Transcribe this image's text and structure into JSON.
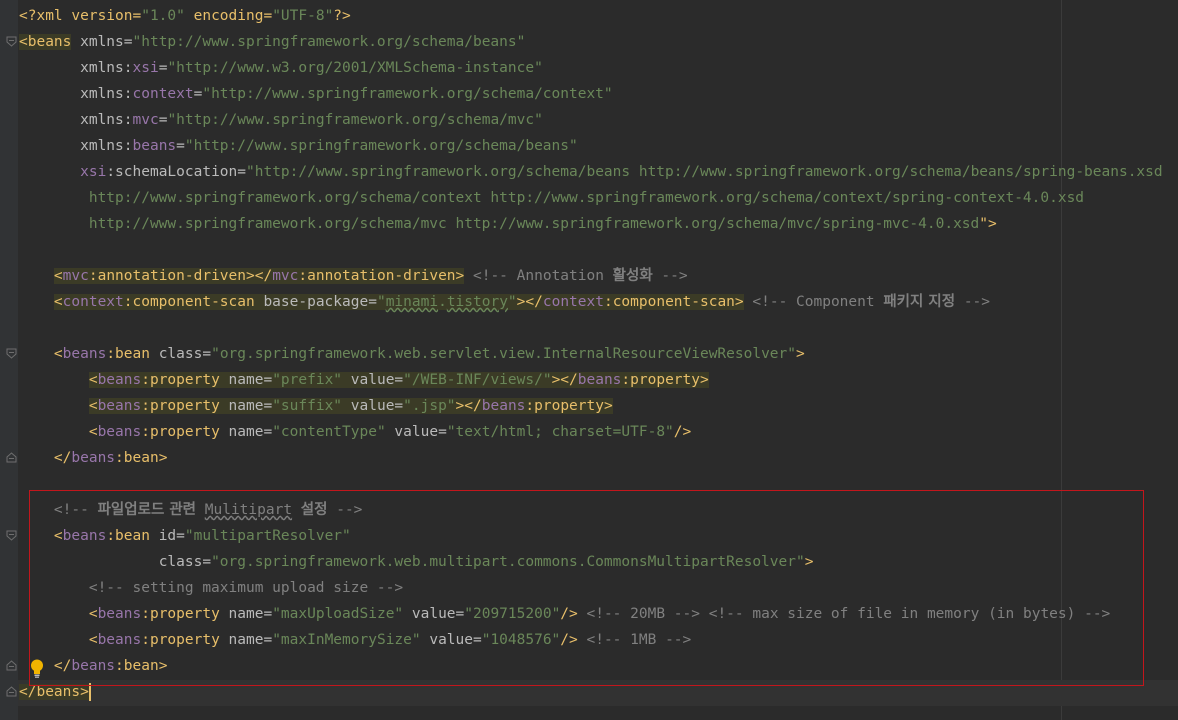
{
  "editor": {
    "lines": [
      {
        "segments": [
          {
            "text": "<?xml version=",
            "cls": "t"
          },
          {
            "text": "\"1.0\"",
            "cls": "v"
          },
          {
            "text": " encoding=",
            "cls": "t"
          },
          {
            "text": "\"UTF-8\"",
            "cls": "v"
          },
          {
            "text": "?>",
            "cls": "t"
          }
        ]
      },
      {
        "segments": [
          {
            "text": "<beans",
            "cls": "t hl"
          },
          {
            "text": " xmlns=",
            "cls": "a"
          },
          {
            "text": "\"http://www.springframework.org/schema/beans\"",
            "cls": "v"
          }
        ]
      },
      {
        "segments": [
          {
            "text": "       xmlns:",
            "cls": "a"
          },
          {
            "text": "xsi",
            "cls": "ns"
          },
          {
            "text": "=",
            "cls": "a"
          },
          {
            "text": "\"http://www.w3.org/2001/XMLSchema-instance\"",
            "cls": "v"
          }
        ]
      },
      {
        "segments": [
          {
            "text": "       xmlns:",
            "cls": "a"
          },
          {
            "text": "context",
            "cls": "ns"
          },
          {
            "text": "=",
            "cls": "a"
          },
          {
            "text": "\"http://www.springframework.org/schema/context\"",
            "cls": "v"
          }
        ]
      },
      {
        "segments": [
          {
            "text": "       xmlns:",
            "cls": "a"
          },
          {
            "text": "mvc",
            "cls": "ns"
          },
          {
            "text": "=",
            "cls": "a"
          },
          {
            "text": "\"http://www.springframework.org/schema/mvc\"",
            "cls": "v"
          }
        ]
      },
      {
        "segments": [
          {
            "text": "       xmlns:",
            "cls": "a"
          },
          {
            "text": "beans",
            "cls": "ns"
          },
          {
            "text": "=",
            "cls": "a"
          },
          {
            "text": "\"http://www.springframework.org/schema/beans\"",
            "cls": "v"
          }
        ]
      },
      {
        "segments": [
          {
            "text": "       ",
            "cls": "a"
          },
          {
            "text": "xsi",
            "cls": "ns"
          },
          {
            "text": ":schemaLocation=",
            "cls": "a"
          },
          {
            "text": "\"http://www.springframework.org/schema/beans http://www.springframework.org/schema/beans/spring-beans.xsd",
            "cls": "v"
          }
        ]
      },
      {
        "segments": [
          {
            "text": "        http://www.springframework.org/schema/context http://www.springframework.org/schema/context/spring-context-4.0.xsd",
            "cls": "v"
          }
        ]
      },
      {
        "segments": [
          {
            "text": "        http://www.springframework.org/schema/mvc http://www.springframework.org/schema/mvc/spring-mvc-4.0.xsd",
            "cls": "v"
          },
          {
            "text": "\">",
            "cls": "t"
          }
        ]
      },
      {
        "segments": []
      },
      {
        "segments": [
          {
            "text": "    ",
            "cls": "a"
          },
          {
            "text": "<",
            "cls": "t hl"
          },
          {
            "text": "mvc",
            "cls": "ns hl"
          },
          {
            "text": ":annotation-driven></",
            "cls": "t hl"
          },
          {
            "text": "mvc",
            "cls": "ns hl"
          },
          {
            "text": ":annotation-driven>",
            "cls": "t hl"
          },
          {
            "text": " <!-- Annotation ",
            "cls": "c"
          },
          {
            "text": "활성화",
            "cls": "c kr"
          },
          {
            "text": " -->",
            "cls": "c"
          }
        ]
      },
      {
        "segments": [
          {
            "text": "    ",
            "cls": "a"
          },
          {
            "text": "<",
            "cls": "t hl"
          },
          {
            "text": "context",
            "cls": "ns hl"
          },
          {
            "text": ":component-scan ",
            "cls": "t hl"
          },
          {
            "text": "base-package=",
            "cls": "a hl"
          },
          {
            "text": "\"",
            "cls": "v hl"
          },
          {
            "text": "minami",
            "cls": "v hl ul"
          },
          {
            "text": ".",
            "cls": "v hl"
          },
          {
            "text": "tistory",
            "cls": "v hl ul"
          },
          {
            "text": "\"",
            "cls": "v hl"
          },
          {
            "text": "></",
            "cls": "t hl"
          },
          {
            "text": "context",
            "cls": "ns hl"
          },
          {
            "text": ":component-scan>",
            "cls": "t hl"
          },
          {
            "text": " <!-- Component ",
            "cls": "c"
          },
          {
            "text": "패키지 지정",
            "cls": "c kr"
          },
          {
            "text": " -->",
            "cls": "c"
          }
        ]
      },
      {
        "segments": []
      },
      {
        "segments": [
          {
            "text": "    <",
            "cls": "t"
          },
          {
            "text": "beans",
            "cls": "ns"
          },
          {
            "text": ":bean ",
            "cls": "t"
          },
          {
            "text": "class=",
            "cls": "a"
          },
          {
            "text": "\"org.springframework.web.servlet.view.InternalResourceViewResolver\"",
            "cls": "v"
          },
          {
            "text": ">",
            "cls": "t"
          }
        ]
      },
      {
        "segments": [
          {
            "text": "        ",
            "cls": "a"
          },
          {
            "text": "<",
            "cls": "t hl"
          },
          {
            "text": "beans",
            "cls": "ns hl"
          },
          {
            "text": ":property ",
            "cls": "t hl"
          },
          {
            "text": "name=",
            "cls": "a hl"
          },
          {
            "text": "\"prefix\"",
            "cls": "v hl"
          },
          {
            "text": " value=",
            "cls": "a hl"
          },
          {
            "text": "\"/WEB-INF/views/\"",
            "cls": "v hl"
          },
          {
            "text": "></",
            "cls": "t hl"
          },
          {
            "text": "beans",
            "cls": "ns hl"
          },
          {
            "text": ":property>",
            "cls": "t hl"
          }
        ]
      },
      {
        "segments": [
          {
            "text": "        ",
            "cls": "a"
          },
          {
            "text": "<",
            "cls": "t hl"
          },
          {
            "text": "beans",
            "cls": "ns hl"
          },
          {
            "text": ":property ",
            "cls": "t hl"
          },
          {
            "text": "name=",
            "cls": "a hl"
          },
          {
            "text": "\"suffix\"",
            "cls": "v hl"
          },
          {
            "text": " value=",
            "cls": "a hl"
          },
          {
            "text": "\".jsp\"",
            "cls": "v hl"
          },
          {
            "text": "></",
            "cls": "t hl"
          },
          {
            "text": "beans",
            "cls": "ns hl"
          },
          {
            "text": ":property>",
            "cls": "t hl"
          }
        ]
      },
      {
        "segments": [
          {
            "text": "        <",
            "cls": "t"
          },
          {
            "text": "beans",
            "cls": "ns"
          },
          {
            "text": ":property ",
            "cls": "t"
          },
          {
            "text": "name=",
            "cls": "a"
          },
          {
            "text": "\"contentType\"",
            "cls": "v"
          },
          {
            "text": " value=",
            "cls": "a"
          },
          {
            "text": "\"text/html; charset=UTF-8\"",
            "cls": "v"
          },
          {
            "text": "/>",
            "cls": "t"
          }
        ]
      },
      {
        "segments": [
          {
            "text": "    </",
            "cls": "t"
          },
          {
            "text": "beans",
            "cls": "ns"
          },
          {
            "text": ":bean>",
            "cls": "t"
          }
        ]
      },
      {
        "segments": []
      },
      {
        "segments": [
          {
            "text": "    <!-- ",
            "cls": "c"
          },
          {
            "text": "파일업로드 관련",
            "cls": "c kr"
          },
          {
            "text": " ",
            "cls": "c"
          },
          {
            "text": "Mulitipart",
            "cls": "c ulc"
          },
          {
            "text": " ",
            "cls": "c"
          },
          {
            "text": "설정",
            "cls": "c kr"
          },
          {
            "text": " -->",
            "cls": "c"
          }
        ]
      },
      {
        "segments": [
          {
            "text": "    <",
            "cls": "t"
          },
          {
            "text": "beans",
            "cls": "ns"
          },
          {
            "text": ":bean ",
            "cls": "t"
          },
          {
            "text": "id=",
            "cls": "a"
          },
          {
            "text": "\"multipartResolver\"",
            "cls": "v"
          }
        ]
      },
      {
        "segments": [
          {
            "text": "                ",
            "cls": "a"
          },
          {
            "text": "class=",
            "cls": "a"
          },
          {
            "text": "\"org.springframework.web.multipart.commons.CommonsMultipartResolver\"",
            "cls": "v"
          },
          {
            "text": ">",
            "cls": "t"
          }
        ]
      },
      {
        "segments": [
          {
            "text": "        <!-- setting maximum upload size -->",
            "cls": "c"
          }
        ]
      },
      {
        "segments": [
          {
            "text": "        <",
            "cls": "t"
          },
          {
            "text": "beans",
            "cls": "ns"
          },
          {
            "text": ":property ",
            "cls": "t"
          },
          {
            "text": "name=",
            "cls": "a"
          },
          {
            "text": "\"maxUploadSize\"",
            "cls": "v"
          },
          {
            "text": " value=",
            "cls": "a"
          },
          {
            "text": "\"209715200\"",
            "cls": "v"
          },
          {
            "text": "/>",
            "cls": "t"
          },
          {
            "text": " <!-- 20MB --> <!-- max size of file in memory (in bytes) -->",
            "cls": "c"
          }
        ]
      },
      {
        "segments": [
          {
            "text": "        <",
            "cls": "t"
          },
          {
            "text": "beans",
            "cls": "ns"
          },
          {
            "text": ":property ",
            "cls": "t"
          },
          {
            "text": "name=",
            "cls": "a"
          },
          {
            "text": "\"maxInMemorySize\"",
            "cls": "v"
          },
          {
            "text": " value=",
            "cls": "a"
          },
          {
            "text": "\"1048576\"",
            "cls": "v"
          },
          {
            "text": "/>",
            "cls": "t"
          },
          {
            "text": " <!-- 1MB -->",
            "cls": "c"
          }
        ]
      },
      {
        "segments": [
          {
            "text": "    </",
            "cls": "t"
          },
          {
            "text": "beans",
            "cls": "ns"
          },
          {
            "text": ":bean>",
            "cls": "t"
          }
        ]
      },
      {
        "segments": [
          {
            "text": "</beans>",
            "cls": "t hl"
          }
        ],
        "cursor": true
      }
    ]
  },
  "colors": {
    "background": "#2b2b2b",
    "tag": "#e8bf6a",
    "attribute": "#bababa",
    "namespace": "#9876aa",
    "value": "#6a8759",
    "comment": "#808080",
    "match_highlight": "#3b3b26",
    "selection_box": "#c3161c"
  },
  "icons": {
    "fold_marker": "fold-icon",
    "intention_bulb": "lightbulb-icon"
  }
}
